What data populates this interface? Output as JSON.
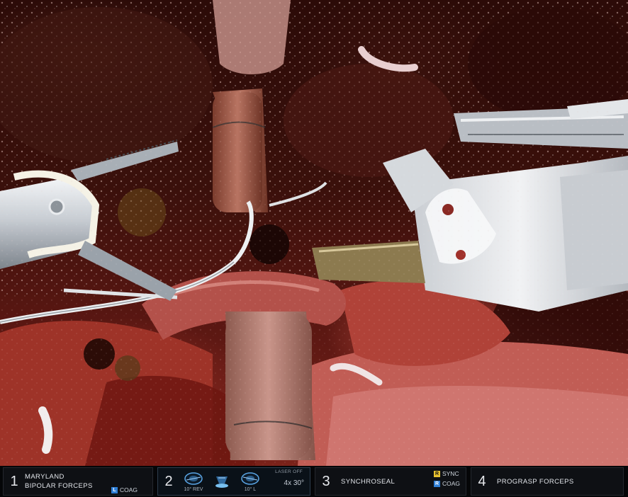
{
  "hud": {
    "slots": [
      {
        "number": "1",
        "tool_line1": "MARYLAND",
        "tool_line2": "BIPOLAR FORCEPS",
        "badge_key": "L",
        "badge_label": "COAG"
      },
      {
        "number": "2",
        "laser": "LASER OFF",
        "cam_left_caption": "10° REV",
        "cam_right_caption": "10° L",
        "zoom": "4x 30°"
      },
      {
        "number": "3",
        "tool_line1": "SYNCHROSEAL",
        "badge_top_key": "R",
        "badge_top_label": "SYNC",
        "badge_bottom_key": "R",
        "badge_bottom_label": "COAG"
      },
      {
        "number": "4",
        "tool_line1": "PROGRASP FORCEPS"
      }
    ]
  },
  "colors": {
    "badge_blue": "#2f7fd6",
    "badge_yellow": "#e8c230",
    "hud_background": "#050608"
  },
  "icons": {
    "camera_left": "endoscope-tip-icon",
    "camera_center": "camera-arm-icon",
    "camera_right": "endoscope-tip-icon"
  }
}
